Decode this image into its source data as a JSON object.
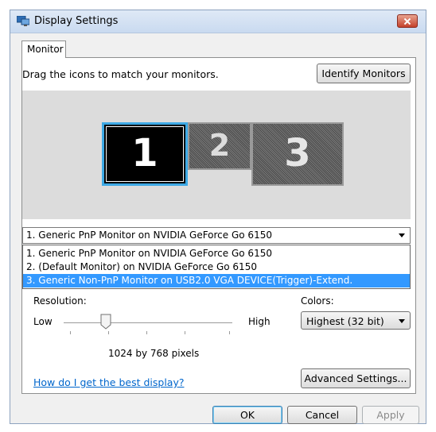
{
  "window": {
    "title": "Display Settings",
    "colors": {
      "titlebar": "#dfe9f6",
      "close": "#c4412b",
      "selection": "#3399ff",
      "link": "#0066cc",
      "active_monitor_border": "#3da9e5"
    }
  },
  "tabs": [
    {
      "label": "Monitor",
      "selected": true
    }
  ],
  "monitor_tab": {
    "instruction": "Drag the icons to match your monitors.",
    "identify_label": "Identify Monitors",
    "monitors": [
      {
        "number": "1",
        "selected": true
      },
      {
        "number": "2",
        "selected": false
      },
      {
        "number": "3",
        "selected": false
      }
    ],
    "display_select": {
      "value": "1. Generic PnP Monitor on NVIDIA GeForce Go 6150",
      "options": [
        "1. Generic PnP Monitor on NVIDIA GeForce Go 6150",
        "2. (Default Monitor) on NVIDIA GeForce Go 6150",
        "3. Generic Non-PnP Monitor on USB2.0 VGA DEVICE(Trigger)-Extend."
      ],
      "highlighted_index": 2
    },
    "resolution": {
      "label": "Resolution:",
      "low": "Low",
      "high": "High",
      "value_text": "1024 by 768 pixels",
      "slider_position": 0.25
    },
    "colors": {
      "label": "Colors:",
      "value": "Highest (32 bit)"
    },
    "help_link": "How do I get the best display?",
    "advanced_label": "Advanced Settings..."
  },
  "footer": {
    "ok": "OK",
    "cancel": "Cancel",
    "apply": "Apply"
  },
  "icons": {
    "app": "display-settings-icon",
    "close": "close-icon",
    "dropdown": "chevron-down-icon",
    "slider": "slider-thumb-icon"
  }
}
